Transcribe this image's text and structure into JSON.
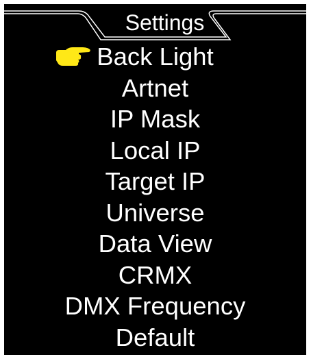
{
  "header": {
    "title": "Settings"
  },
  "menu": {
    "selected_index": 0,
    "pointer_icon": "hand-pointing-right-icon",
    "pointer_color": "#ffe817",
    "items": [
      {
        "label": "Back Light"
      },
      {
        "label": "Artnet"
      },
      {
        "label": "IP Mask"
      },
      {
        "label": "Local IP"
      },
      {
        "label": "Target IP"
      },
      {
        "label": "Universe"
      },
      {
        "label": "Data View"
      },
      {
        "label": "CRMX"
      },
      {
        "label": "DMX Frequency"
      },
      {
        "label": "Default"
      }
    ]
  },
  "colors": {
    "background": "#000000",
    "text": "#ffffff",
    "frame": "#ffffff"
  }
}
